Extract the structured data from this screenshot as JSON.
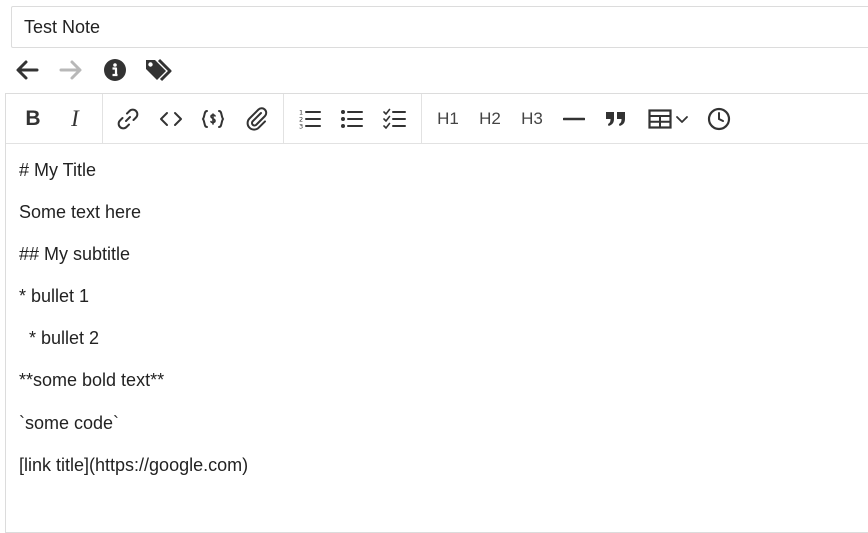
{
  "note": {
    "title": "Test Note"
  },
  "nav": {
    "back_icon": "arrow-left-icon",
    "forward_icon": "arrow-right-icon",
    "info_icon": "info-circle-icon",
    "tags_icon": "tags-icon"
  },
  "toolbar": {
    "bold": "B",
    "italic": "I",
    "h1": "H1",
    "h2": "H2",
    "h3": "H3"
  },
  "editor": {
    "lines": [
      "# My Title",
      "Some text here",
      "## My subtitle",
      "* bullet 1",
      "  * bullet 2",
      "**some bold text**",
      "`some code`",
      "[link title](https://google.com)"
    ]
  },
  "colors": {
    "icon": "#333333",
    "icon_disabled": "#b8b8b8",
    "border": "#dcdcdc"
  }
}
